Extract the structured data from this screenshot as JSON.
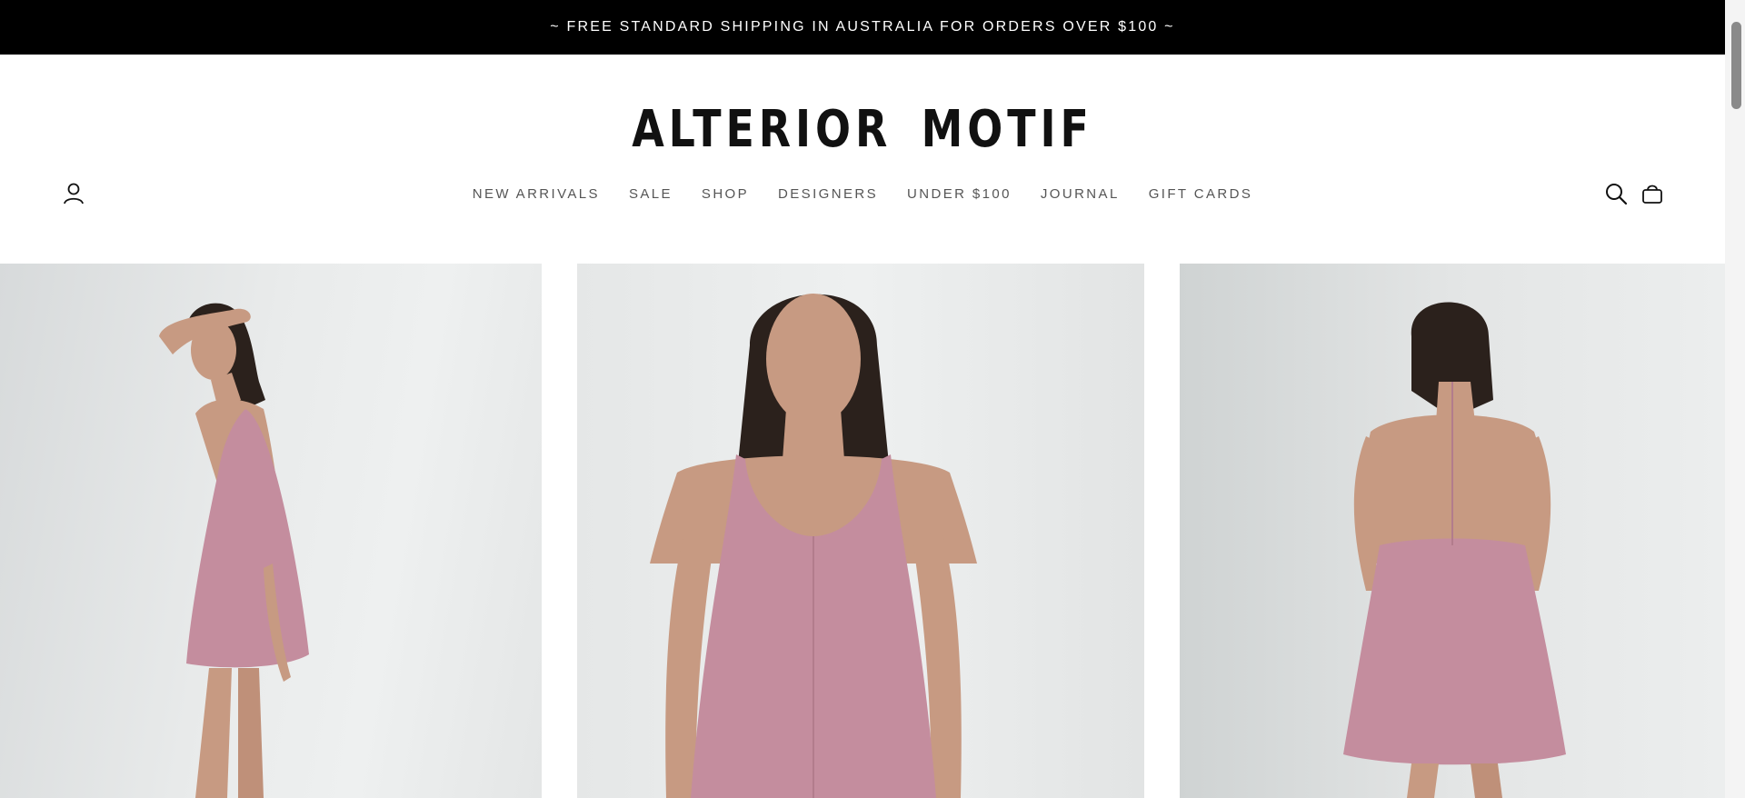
{
  "announcement": {
    "text": "~ FREE STANDARD SHIPPING IN AUSTRALIA FOR ORDERS OVER $100 ~"
  },
  "header": {
    "logo": "ALTERIOR MOTIF",
    "icons": {
      "account": "account-icon",
      "search": "search-icon",
      "cart": "bag-icon"
    }
  },
  "nav": {
    "items": [
      {
        "label": "NEW ARRIVALS"
      },
      {
        "label": "SALE"
      },
      {
        "label": "SHOP"
      },
      {
        "label": "DESIGNERS"
      },
      {
        "label": "UNDER $100"
      },
      {
        "label": "JOURNAL"
      },
      {
        "label": "GIFT CARDS"
      }
    ]
  },
  "gallery": {
    "images": [
      {
        "subject": "model in pink striped halter mini dress, side view"
      },
      {
        "subject": "model in pink striped halter mini dress, front view"
      },
      {
        "subject": "model in pink striped halter mini dress, back view"
      }
    ]
  },
  "colors": {
    "announcement_bg": "#000000",
    "announcement_text": "#ffffff",
    "dress": "#c48d9e",
    "skin": "#c79a82",
    "hair": "#2b211c"
  }
}
